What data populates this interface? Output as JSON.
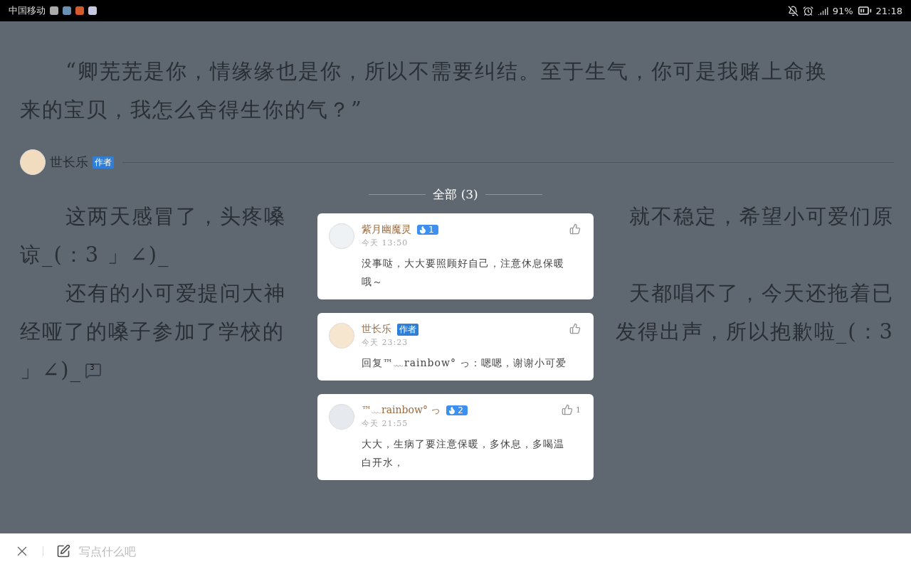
{
  "status_bar": {
    "carrier": "中国移动",
    "battery": "91%",
    "time": "21:18"
  },
  "reader": {
    "paragraph_1": [
      "“卿芜芜是你，情缘缘也是你，所以不需要纠结。至于生气，你可是我赌上命换",
      "来的宝贝，我怎么舍得生你的气？”"
    ],
    "author": {
      "name": "世长乐",
      "tag": "作者"
    },
    "lines": [
      {
        "indent": true,
        "left": "这两天感冒了，头疼嗓",
        "right": "就不稳定，希望小可爱们原"
      },
      {
        "indent": false,
        "left": "谅_(：3 」∠)_"
      },
      {
        "indent": true,
        "left": "还有的小可爱提问大神",
        "right": "天都唱不了，今天还拖着已"
      },
      {
        "indent": false,
        "left": "经哑了的嗓子参加了学校的",
        "right": "发得出声，所以抱歉啦_(：3"
      },
      {
        "indent": false,
        "left": "」∠)_"
      }
    ],
    "comment_count": "3"
  },
  "comments_popup": {
    "title": "全部 (3)",
    "comments": [
      {
        "name": "紫月幽魔灵",
        "badge": {
          "kind": "fan",
          "text": "1"
        },
        "time": "今天 13:50",
        "text": "没事哒，大大要照顾好自己，注意休息保暖哦～"
      },
      {
        "name": "世长乐",
        "badge": {
          "kind": "author",
          "text": "作者"
        },
        "time": "今天 23:23",
        "text": "回复™﹏rainbow° っ：嗯嗯，谢谢小可爱"
      },
      {
        "name": "™﹏rainbow° っ",
        "badge": {
          "kind": "fan",
          "text": "2"
        },
        "time": "今天 21:55",
        "text": "大大，生病了要注意保暖，多休息，多喝温白开水，",
        "likes": "1"
      }
    ]
  },
  "bottom_bar": {
    "placeholder": "写点什么吧"
  }
}
